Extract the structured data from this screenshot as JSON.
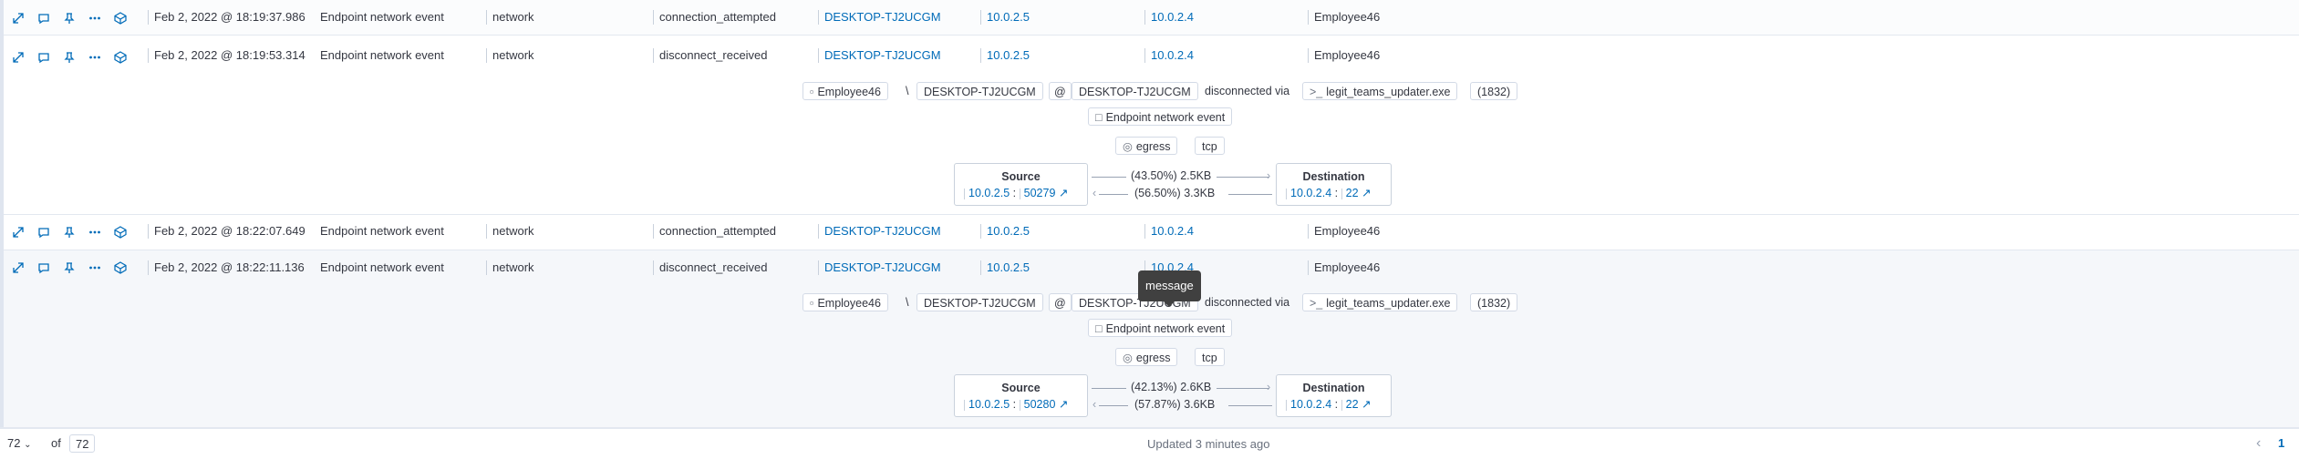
{
  "rows": [
    {
      "timestamp": "Feb 2, 2022 @ 18:19:37.986",
      "message": "Endpoint network event",
      "category": "network",
      "action": "connection_attempted",
      "host": "DESKTOP-TJ2UCGM",
      "source_ip": "10.0.2.5",
      "dest_ip": "10.0.2.4",
      "user": "Employee46"
    },
    {
      "timestamp": "Feb 2, 2022 @ 18:19:53.314",
      "message": "Endpoint network event",
      "category": "network",
      "action": "disconnect_received",
      "host": "DESKTOP-TJ2UCGM",
      "source_ip": "10.0.2.5",
      "dest_ip": "10.0.2.4",
      "user": "Employee46",
      "detail": {
        "user": "Employee46",
        "backslash": "\\",
        "host": "DESKTOP-TJ2UCGM",
        "at": "@",
        "host2": "DESKTOP-TJ2UCGM",
        "via": "disconnected via",
        "process": "legit_teams_updater.exe",
        "pid": "(1832)",
        "event": "Endpoint network event",
        "direction": "egress",
        "transport": "tcp",
        "source_title": "Source",
        "source_ip": "10.0.2.5",
        "source_port": "50279",
        "dest_title": "Destination",
        "dest_ip": "10.0.2.4",
        "dest_port": "22",
        "out_pct": "(43.50%)",
        "out_bytes": "2.5KB",
        "in_pct": "(56.50%)",
        "in_bytes": "3.3KB",
        "colon": ":"
      }
    },
    {
      "timestamp": "Feb 2, 2022 @ 18:22:07.649",
      "message": "Endpoint network event",
      "category": "network",
      "action": "connection_attempted",
      "host": "DESKTOP-TJ2UCGM",
      "source_ip": "10.0.2.5",
      "dest_ip": "10.0.2.4",
      "user": "Employee46"
    },
    {
      "timestamp": "Feb 2, 2022 @ 18:22:11.136",
      "message": "Endpoint network event",
      "category": "network",
      "action": "disconnect_received",
      "host": "DESKTOP-TJ2UCGM",
      "source_ip": "10.0.2.5",
      "dest_ip": "10.0.2.4",
      "user": "Employee46",
      "detail": {
        "user": "Employee46",
        "backslash": "\\",
        "host": "DESKTOP-TJ2UCGM",
        "at": "@",
        "host2": "DESKTOP-TJ2UCGM",
        "via": "disconnected via",
        "process": "legit_teams_updater.exe",
        "pid": "(1832)",
        "event": "Endpoint network event",
        "direction": "egress",
        "transport": "tcp",
        "source_title": "Source",
        "source_ip": "10.0.2.5",
        "source_port": "50280",
        "dest_title": "Destination",
        "dest_ip": "10.0.2.4",
        "dest_port": "22",
        "out_pct": "(42.13%)",
        "out_bytes": "2.6KB",
        "in_pct": "(57.87%)",
        "in_bytes": "3.6KB",
        "colon": ":"
      }
    }
  ],
  "tooltip": {
    "text": "message"
  },
  "footer": {
    "rows_per_page": "72",
    "of_label": "of",
    "total": "72",
    "updated": "Updated 3 minutes ago",
    "current_page": "1"
  },
  "icons": [
    "expand-icon",
    "comment-icon",
    "pin-icon",
    "more-icon",
    "analyze-icon",
    "chevron-down-icon",
    "chevron-left-icon",
    "external-link-icon",
    "user-icon",
    "message-icon",
    "direction-icon",
    "terminal-icon"
  ],
  "colors": {
    "link": "#006bb8",
    "row_highlight": "#f5f7fa",
    "text": "#343741"
  }
}
